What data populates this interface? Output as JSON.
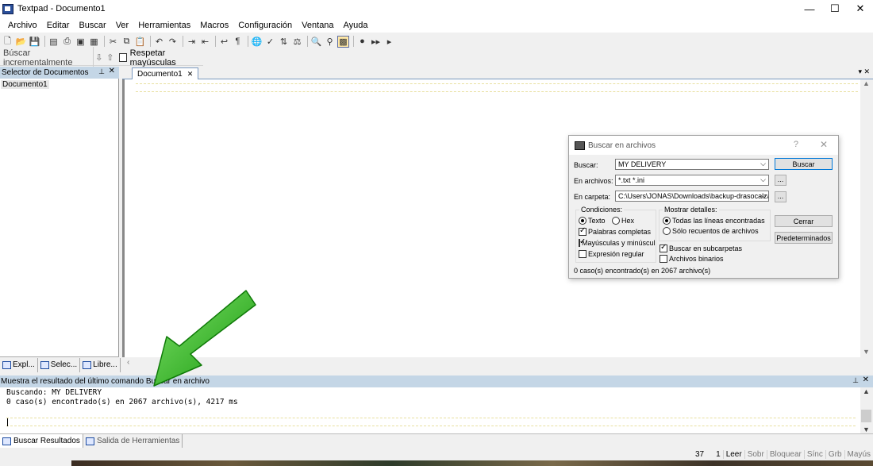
{
  "window": {
    "title": "Textpad - Documento1",
    "controls": [
      "—",
      "☐",
      "✕"
    ]
  },
  "menu": [
    "Archivo",
    "Editar",
    "Buscar",
    "Ver",
    "Herramientas",
    "Macros",
    "Configuración",
    "Ventana",
    "Ayuda"
  ],
  "toolbar_icons": [
    "new-file-icon",
    "open-folder-icon",
    "save-icon",
    "save-all-icon",
    "print-icon",
    "print-preview-icon",
    "manage-files-icon",
    "cut-icon",
    "copy-icon",
    "paste-icon",
    "undo-icon",
    "redo-icon",
    "indent-icon",
    "outdent-icon",
    "word-wrap-icon",
    "visible-spaces-icon",
    "browser-icon",
    "spell-check-icon",
    "sort-icon",
    "compare-icon",
    "find-icon",
    "find-next-icon",
    "find-in-files-icon",
    "macro-record-icon",
    "macro-play-icon",
    "macro-step-icon"
  ],
  "incremental_search": {
    "label": "Búscar incrementalmente",
    "checkbox_label": "Respetar mayúsculas"
  },
  "left_panel": {
    "title": "Selector de Documentos",
    "documents": [
      "Documento1"
    ],
    "tabs": [
      "Expl...",
      "Selec...",
      "Libre..."
    ]
  },
  "editor": {
    "tab_label": "Documento1"
  },
  "dialog": {
    "title": "Buscar en archivos",
    "help": "?",
    "close": "✕",
    "find_label": "Buscar:",
    "find_value": "MY DELIVERY",
    "files_label": "En archivos:",
    "files_value": "*.txt *.ini",
    "folder_label": "En carpeta:",
    "folder_value": "C:\\Users\\JONAS\\Downloads\\backup-drasocalza",
    "browse": "...",
    "btn_find": "Buscar",
    "btn_close": "Cerrar",
    "btn_defaults": "Predeterminados",
    "conditions_label": "Condiciones:",
    "opt_text": "Texto",
    "opt_hex": "Hex",
    "opt_words": "Palabras completas",
    "opt_case": "Mayúsculas y minúsculas",
    "opt_regex": "Expresión regular",
    "details_label": "Mostrar detalles:",
    "opt_all_lines": "Todas las líneas encontradas",
    "opt_counts": "Sólo recuentos de archivos",
    "opt_subfolders": "Buscar en subcarpetas",
    "opt_binary": "Archivos binarios",
    "status": "0 caso(s) encontrado(s) en 2067 archivo(s)"
  },
  "results": {
    "title": "Muestra el resultado del último comando Buscar en archivo",
    "line1": "Buscando: MY DELIVERY",
    "line2": "0 caso(s) encontrado(s) en 2067 archivo(s), 4217 ms",
    "tab_results": "Buscar Resultados",
    "tab_tools": "Salida de Herramientas"
  },
  "statusbar": {
    "line": "37",
    "col": "1",
    "read": "Leer",
    "ovr": "Sobr",
    "block": "Bloquear",
    "sync": "Sínc",
    "rec": "Grb",
    "caps": "Mayús"
  },
  "colors": {
    "panel_header": "#c4d6e6",
    "arrow_green": "#22b014",
    "accent": "#0078d7"
  }
}
